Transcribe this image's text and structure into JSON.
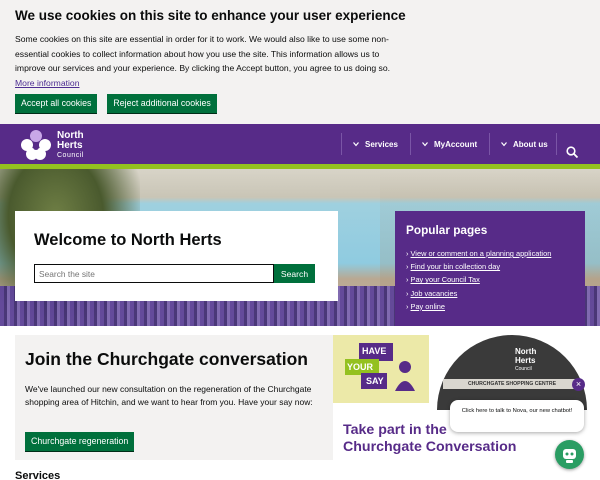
{
  "cookie_banner": {
    "title": "We use cookies on this site to enhance your user experience",
    "body": "Some cookies on this site are essential in order for it to work. We would also like to use some non-essential cookies to collect information about how you use the site. This information allows us to improve our services and your experience. By clicking the Accept button, you agree to us doing so.",
    "more_info_link": "More information",
    "accept_button": "Accept all cookies",
    "reject_button": "Reject additional cookies"
  },
  "header": {
    "logo_line1": "North",
    "logo_line2": "Herts",
    "logo_line3": "Council",
    "nav": [
      {
        "label": "Services"
      },
      {
        "label": "MyAccount"
      },
      {
        "label": "About us"
      }
    ],
    "colors": {
      "brand": "#572b88",
      "accent": "#94c11f",
      "button": "#00703c"
    }
  },
  "welcome": {
    "title": "Welcome to North Herts",
    "search_placeholder": "Search the site",
    "search_button": "Search"
  },
  "popular_pages": {
    "title": "Popular pages",
    "items": [
      "View or comment on a planning application",
      "Find your bin collection day",
      "Pay your Council Tax",
      "Job vacancies",
      "Pay online"
    ]
  },
  "churchgate": {
    "title": "Join the Churchgate conversation",
    "body": "We've launched our new consultation on the regeneration of the Churchgate shopping area of Hitchin, and we want to hear from you. Have your say now:",
    "button": "Churchgate regeneration"
  },
  "promo": {
    "have": "HAVE",
    "your": "YOUR",
    "say": "SAY",
    "sign": "CHURCHGATE SHOPPING CENTRE",
    "nh_line1": "North",
    "nh_line2": "Herts",
    "nh_line3": "Council",
    "title_line1": "Take part in the",
    "title_line2": "Churchgate Conversation"
  },
  "chatbot": {
    "message": "Click here to talk to Nova, our new chatbot!",
    "close": "×"
  },
  "services_heading": "Services"
}
